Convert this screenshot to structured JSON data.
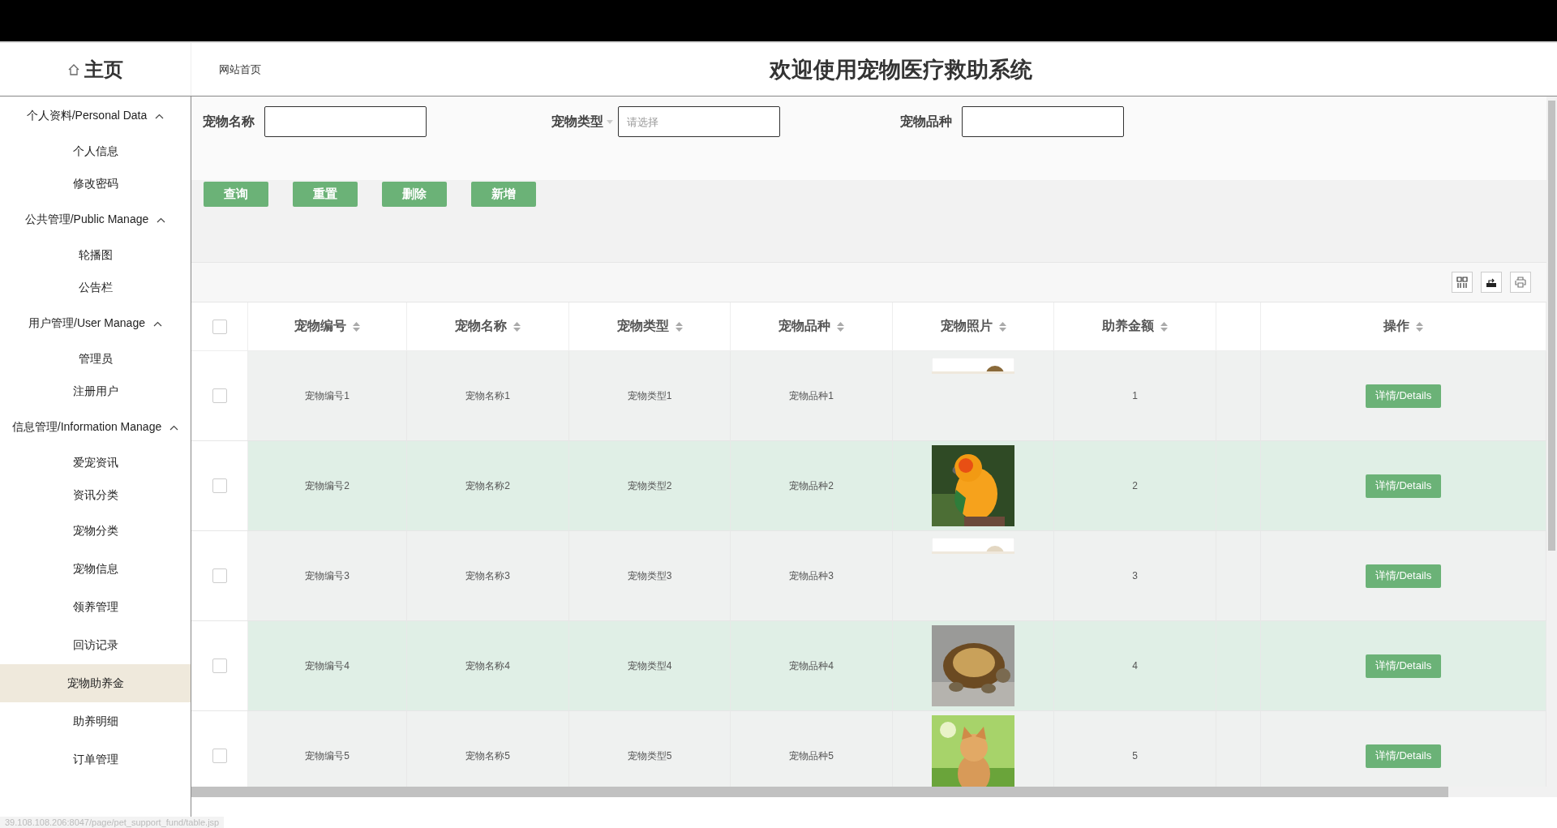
{
  "header": {
    "home": "主页",
    "breadcrumb": "网站首页",
    "title": "欢迎使用宠物医疗救助系统"
  },
  "sidebar": {
    "groups": [
      {
        "label": "个人资料/Personal Data",
        "expanded": true,
        "items": [
          {
            "label": "个人信息",
            "selected": false
          },
          {
            "label": "修改密码",
            "selected": false
          }
        ]
      },
      {
        "label": "公共管理/Public Manage",
        "expanded": true,
        "items": [
          {
            "label": "轮播图",
            "selected": false
          },
          {
            "label": "公告栏",
            "selected": false
          }
        ]
      },
      {
        "label": "用户管理/User Manage",
        "expanded": true,
        "items": [
          {
            "label": "管理员",
            "selected": false
          },
          {
            "label": "注册用户",
            "selected": false
          }
        ]
      },
      {
        "label": "信息管理/Information Manage",
        "expanded": true,
        "items": [
          {
            "label": "爱宠资讯",
            "selected": false
          },
          {
            "label": "资讯分类",
            "selected": false
          },
          {
            "label": "宠物分类",
            "selected": false
          },
          {
            "label": "宠物信息",
            "selected": false
          },
          {
            "label": "领养管理",
            "selected": false
          },
          {
            "label": "回访记录",
            "selected": false
          },
          {
            "label": "宠物助养金",
            "selected": true
          },
          {
            "label": "助养明细",
            "selected": false
          },
          {
            "label": "订单管理",
            "selected": false
          }
        ]
      }
    ]
  },
  "search": {
    "fields": [
      {
        "label": "宠物名称",
        "kind": "text"
      },
      {
        "label": "宠物类型",
        "kind": "select",
        "placeholder": "请选择"
      },
      {
        "label": "宠物品种",
        "kind": "text"
      }
    ]
  },
  "actions": [
    "查询",
    "重置",
    "删除",
    "新增"
  ],
  "table": {
    "select_all": false,
    "columns": [
      {
        "label": "宠物编号"
      },
      {
        "label": "宠物名称"
      },
      {
        "label": "宠物类型"
      },
      {
        "label": "宠物品种"
      },
      {
        "label": "宠物照片"
      },
      {
        "label": "助养金额"
      },
      {
        "label": "操作"
      }
    ],
    "rows": [
      {
        "selected": false,
        "cells": [
          "宠物编号1",
          "宠物名称1",
          "宠物类型1",
          "宠物品种1"
        ],
        "photo": {
          "kind": "picture",
          "loaded": false
        },
        "amount": "1",
        "action": "详情/Details"
      },
      {
        "selected": false,
        "cells": [
          "宠物编号2",
          "宠物名称2",
          "宠物类型2",
          "宠物品种2"
        ],
        "photo": {
          "kind": "picture",
          "loaded": true
        },
        "amount": "2",
        "action": "详情/Details"
      },
      {
        "selected": false,
        "cells": [
          "宠物编号3",
          "宠物名称3",
          "宠物类型3",
          "宠物品种3"
        ],
        "photo": {
          "kind": "picture",
          "loaded": false
        },
        "amount": "3",
        "action": "详情/Details"
      },
      {
        "selected": false,
        "cells": [
          "宠物编号4",
          "宠物名称4",
          "宠物类型4",
          "宠物品种4"
        ],
        "photo": {
          "kind": "picture",
          "loaded": true
        },
        "amount": "4",
        "action": "详情/Details"
      },
      {
        "selected": false,
        "cells": [
          "宠物编号5",
          "宠物名称5",
          "宠物类型5",
          "宠物品种5"
        ],
        "photo": {
          "kind": "picture",
          "loaded": true
        },
        "amount": "5",
        "action": "详情/Details"
      }
    ]
  },
  "status_bar": {
    "url": "39.108.108.206:8047/page/pet_support_fund/table.jsp"
  }
}
